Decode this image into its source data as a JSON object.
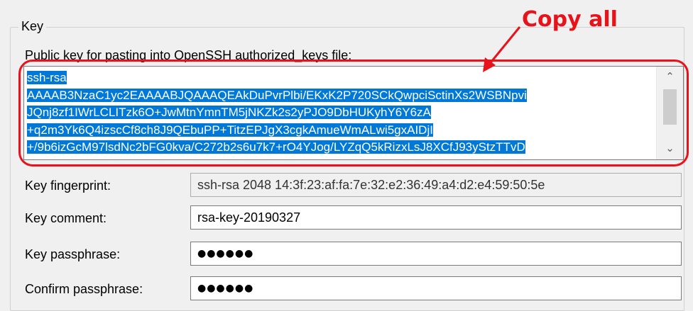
{
  "group": {
    "title": "Key"
  },
  "public_key": {
    "label": "Public key for pasting into OpenSSH authorized_keys file:",
    "lines": [
      "ssh-rsa",
      "AAAAB3NzaC1yc2EAAAABJQAAAQEAkDuPvrPlbi/EKxK2P720SCkQwpciSctinXs2WSBNpvi",
      "JQnj8zf1IWrLCLITzk6O+JwMtnYmnTM5jNKZk2s2yPJO9DbHUKyhY6Y6zA",
      "+q2m3Yk6Q4izscCf8ch8J9QEbuPP+TitzEPJgX3cgkAmueWmALwi5gxAIDjI",
      "+/9b6izGcM97lsdNc2bFG0kva/C272b2s6u7k7+rO4YJog/LYZqQ5kRizxLsJ8XCfJ93yStzTTvD"
    ],
    "scrollbar": {
      "up_icon": "chevron-up-icon",
      "down_icon": "chevron-down-icon"
    }
  },
  "annotation": {
    "text": "Copy all",
    "color": "#e8121b"
  },
  "fields": {
    "fingerprint": {
      "label": "Key fingerprint:",
      "value": "ssh-rsa 2048 14:3f:23:af:fa:7e:32:e2:36:49:a4:d2:e4:59:50:5e"
    },
    "comment": {
      "label": "Key comment:",
      "value": "rsa-key-20190327"
    },
    "passphrase": {
      "label": "Key passphrase:",
      "value": "●●●●●●"
    },
    "confirm": {
      "label": "Confirm passphrase:",
      "value": "●●●●●●"
    }
  },
  "colors": {
    "selection": "#0078d7",
    "background": "#f0f0f0"
  }
}
